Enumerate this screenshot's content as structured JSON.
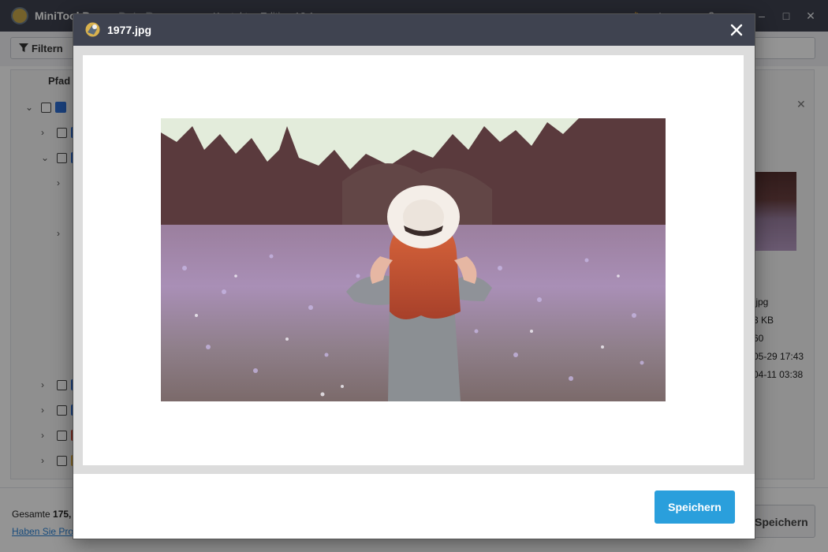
{
  "app": {
    "title": "MiniTool P",
    "title_rest": "ower Data Recovery",
    "menu_fragment_1": "Kontakt",
    "menu_fragment_2": "Edition 12.1",
    "filter_label": "Filtern",
    "tree_header": "Pfad",
    "status_total_prefix": "Gesamte ",
    "status_total_value": "175,",
    "help_link": "Haben Sie Pro",
    "save_partial": "Speichern",
    "details": {
      "name_fragment": ".jpg",
      "size_fragment": "3 KB",
      "dim_fragment": "60",
      "created_fragment": "05-29 17:43",
      "modified_fragment": "04-11 03:38"
    }
  },
  "dialog": {
    "title": "1977.jpg",
    "save_label": "Speichern"
  },
  "colors": {
    "titlebar": "#3f4350",
    "accent": "#2a9fdc",
    "link": "#2a82d6"
  }
}
